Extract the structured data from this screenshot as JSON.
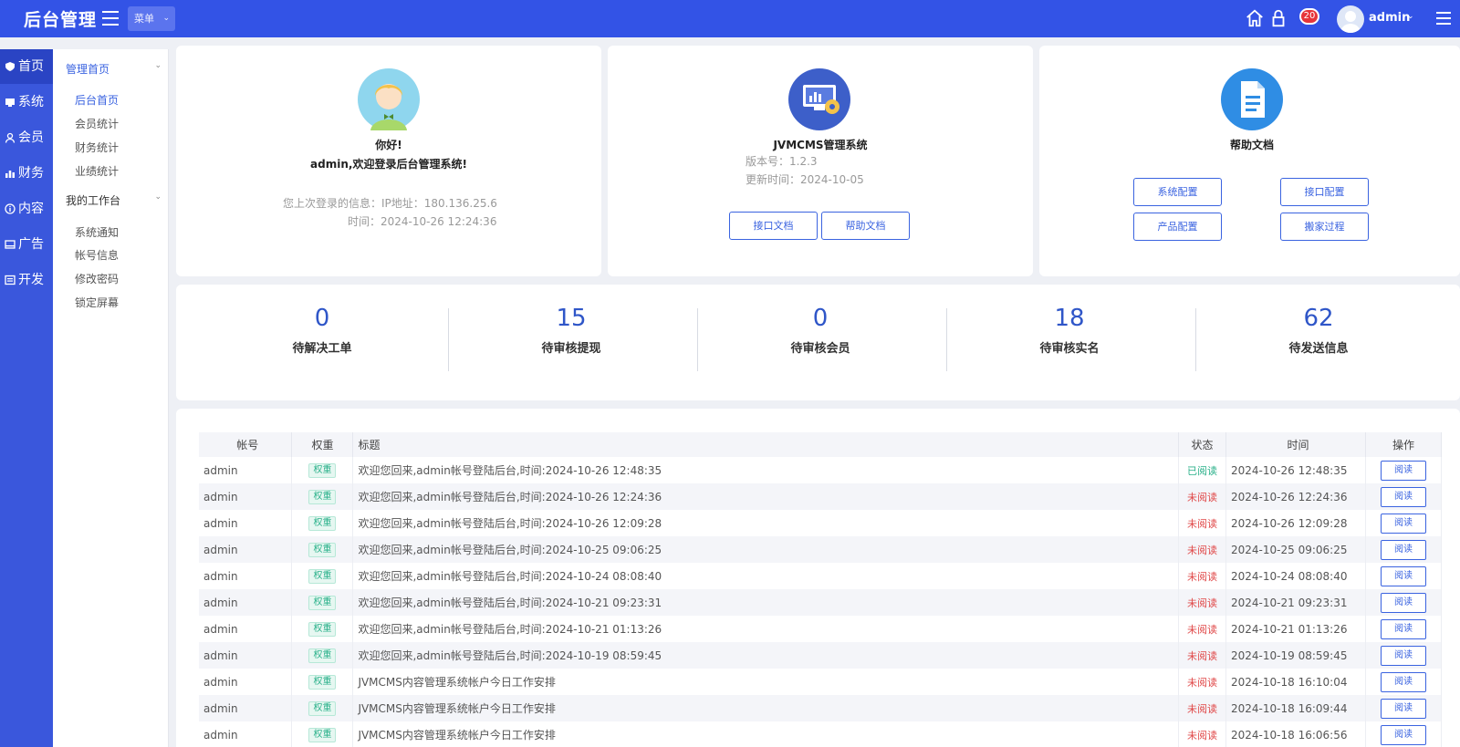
{
  "header": {
    "brand": "后台管理",
    "menu_dropdown": "菜单",
    "badge_count": "20",
    "username": "admin",
    "icons": [
      "home-icon",
      "lock-icon",
      "bell-icon",
      "user-avatar",
      "hamburger-icon"
    ]
  },
  "rail": {
    "items": [
      {
        "label": "首页",
        "icon": "shield-icon"
      },
      {
        "label": "系统",
        "icon": "monitor-icon"
      },
      {
        "label": "会员",
        "icon": "user-icon"
      },
      {
        "label": "财务",
        "icon": "bar-chart-icon"
      },
      {
        "label": "内容",
        "icon": "info-icon"
      },
      {
        "label": "广告",
        "icon": "ad-icon"
      },
      {
        "label": "开发",
        "icon": "code-icon"
      }
    ]
  },
  "submenu": {
    "group1": "管理首页",
    "group1_items": [
      "后台首页",
      "会员统计",
      "财务统计",
      "业绩统计"
    ],
    "group2": "我的工作台",
    "group2_items": [
      "系统通知",
      "帐号信息",
      "修改密码",
      "锁定屏幕"
    ]
  },
  "welcome": {
    "greeting": "你好!",
    "message": "admin,欢迎登录后台管理系统!",
    "last_login": "您上次登录的信息：IP地址：180.136.25.6",
    "time": "时间：2024-10-26 12:24:36"
  },
  "system": {
    "name": "JVMCMS管理系统",
    "version": "版本号：1.2.3",
    "updated": "更新时间：2024-10-05",
    "btn_api": "接口文档",
    "btn_help": "帮助文档"
  },
  "help": {
    "title": "帮助文档",
    "btn_sys": "系统配置",
    "btn_api": "接口配置",
    "btn_product": "产品配置",
    "btn_move": "搬家过程"
  },
  "stats": [
    {
      "value": "0",
      "label": "待解决工单"
    },
    {
      "value": "15",
      "label": "待审核提现"
    },
    {
      "value": "0",
      "label": "待审核会员"
    },
    {
      "value": "18",
      "label": "待审核实名"
    },
    {
      "value": "62",
      "label": "待发送信息"
    }
  ],
  "table": {
    "headers": {
      "account": "帐号",
      "weight": "权重",
      "title": "标题",
      "status": "状态",
      "time": "时间",
      "op": "操作"
    },
    "weight_tag": "权重",
    "read_label": "阅读",
    "rows": [
      {
        "account": "admin",
        "title": "欢迎您回来,admin帐号登陆后台,时间:2024-10-26 12:48:35",
        "status": "已阅读",
        "read": true,
        "time": "2024-10-26 12:48:35"
      },
      {
        "account": "admin",
        "title": "欢迎您回来,admin帐号登陆后台,时间:2024-10-26 12:24:36",
        "status": "未阅读",
        "read": false,
        "time": "2024-10-26 12:24:36"
      },
      {
        "account": "admin",
        "title": "欢迎您回来,admin帐号登陆后台,时间:2024-10-26 12:09:28",
        "status": "未阅读",
        "read": false,
        "time": "2024-10-26 12:09:28"
      },
      {
        "account": "admin",
        "title": "欢迎您回来,admin帐号登陆后台,时间:2024-10-25 09:06:25",
        "status": "未阅读",
        "read": false,
        "time": "2024-10-25 09:06:25"
      },
      {
        "account": "admin",
        "title": "欢迎您回来,admin帐号登陆后台,时间:2024-10-24 08:08:40",
        "status": "未阅读",
        "read": false,
        "time": "2024-10-24 08:08:40"
      },
      {
        "account": "admin",
        "title": "欢迎您回来,admin帐号登陆后台,时间:2024-10-21 09:23:31",
        "status": "未阅读",
        "read": false,
        "time": "2024-10-21 09:23:31"
      },
      {
        "account": "admin",
        "title": "欢迎您回来,admin帐号登陆后台,时间:2024-10-21 01:13:26",
        "status": "未阅读",
        "read": false,
        "time": "2024-10-21 01:13:26"
      },
      {
        "account": "admin",
        "title": "欢迎您回来,admin帐号登陆后台,时间:2024-10-19 08:59:45",
        "status": "未阅读",
        "read": false,
        "time": "2024-10-19 08:59:45"
      },
      {
        "account": "admin",
        "title": "JVMCMS内容管理系统帐户今日工作安排",
        "status": "未阅读",
        "read": false,
        "time": "2024-10-18 16:10:04"
      },
      {
        "account": "admin",
        "title": "JVMCMS内容管理系统帐户今日工作安排",
        "status": "未阅读",
        "read": false,
        "time": "2024-10-18 16:09:44"
      },
      {
        "account": "admin",
        "title": "JVMCMS内容管理系统帐户今日工作安排",
        "status": "未阅读",
        "read": false,
        "time": "2024-10-18 16:06:56"
      }
    ]
  }
}
